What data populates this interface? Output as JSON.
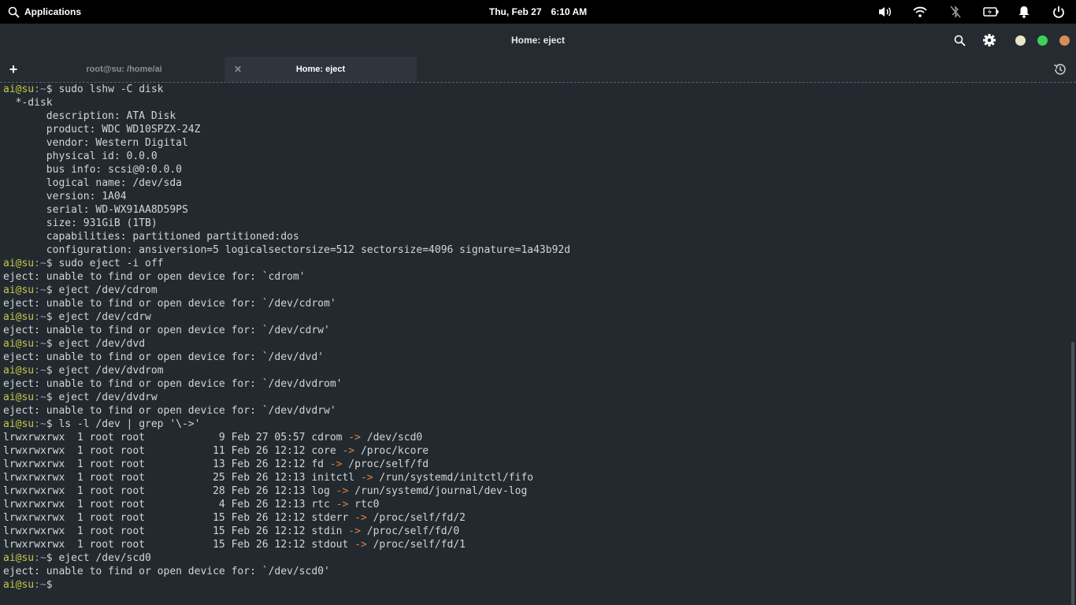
{
  "panel": {
    "apps_label": "Applications",
    "date": "Thu, Feb 27",
    "time": "6:10 AM"
  },
  "window": {
    "title": "Home: eject"
  },
  "tabs": [
    {
      "label": "root@su: /home/ai"
    },
    {
      "label": "Home: eject"
    }
  ],
  "colors": {
    "prompt_user": "#c9c64a",
    "arrow": "#e0803a",
    "background": "#222a30",
    "dot_1": "#e6e6c8",
    "dot_2": "#3cd15a",
    "dot_3": "#d98a5a"
  },
  "terminal": {
    "prompt_user": "ai@su",
    "prompt_sep": ":",
    "prompt_path": "~",
    "prompt_sym": "$",
    "lines": [
      {
        "t": "cmd",
        "text": " sudo lshw -C disk"
      },
      {
        "t": "out",
        "text": "  *-disk"
      },
      {
        "t": "out",
        "text": "       description: ATA Disk"
      },
      {
        "t": "out",
        "text": "       product: WDC WD10SPZX-24Z"
      },
      {
        "t": "out",
        "text": "       vendor: Western Digital"
      },
      {
        "t": "out",
        "text": "       physical id: 0.0.0"
      },
      {
        "t": "out",
        "text": "       bus info: scsi@0:0.0.0"
      },
      {
        "t": "out",
        "text": "       logical name: /dev/sda"
      },
      {
        "t": "out",
        "text": "       version: 1A04"
      },
      {
        "t": "out",
        "text": "       serial: WD-WX91AA8D59PS"
      },
      {
        "t": "out",
        "text": "       size: 931GiB (1TB)"
      },
      {
        "t": "out",
        "text": "       capabilities: partitioned partitioned:dos"
      },
      {
        "t": "out",
        "text": "       configuration: ansiversion=5 logicalsectorsize=512 sectorsize=4096 signature=1a43b92d"
      },
      {
        "t": "cmd",
        "text": " sudo eject -i off"
      },
      {
        "t": "out",
        "text": "eject: unable to find or open device for: `cdrom'"
      },
      {
        "t": "cmd",
        "text": " eject /dev/cdrom"
      },
      {
        "t": "out",
        "text": "eject: unable to find or open device for: `/dev/cdrom'"
      },
      {
        "t": "cmd",
        "text": " eject /dev/cdrw"
      },
      {
        "t": "out",
        "text": "eject: unable to find or open device for: `/dev/cdrw'"
      },
      {
        "t": "cmd",
        "text": " eject /dev/dvd"
      },
      {
        "t": "out",
        "text": "eject: unable to find or open device for: `/dev/dvd'"
      },
      {
        "t": "cmd",
        "text": " eject /dev/dvdrom"
      },
      {
        "t": "out",
        "text": "eject: unable to find or open device for: `/dev/dvdrom'"
      },
      {
        "t": "cmd",
        "text": " eject /dev/dvdrw"
      },
      {
        "t": "out",
        "text": "eject: unable to find or open device for: `/dev/dvdrw'"
      },
      {
        "t": "cmd",
        "text": " ls -l /dev | grep '\\->'"
      },
      {
        "t": "ls",
        "left": "lrwxrwxrwx  1 root root            9 Feb 27 05:57 cdrom ",
        "right": " /dev/scd0"
      },
      {
        "t": "ls",
        "left": "lrwxrwxrwx  1 root root           11 Feb 26 12:12 core ",
        "right": " /proc/kcore"
      },
      {
        "t": "ls",
        "left": "lrwxrwxrwx  1 root root           13 Feb 26 12:12 fd ",
        "right": " /proc/self/fd"
      },
      {
        "t": "ls",
        "left": "lrwxrwxrwx  1 root root           25 Feb 26 12:13 initctl ",
        "right": " /run/systemd/initctl/fifo"
      },
      {
        "t": "ls",
        "left": "lrwxrwxrwx  1 root root           28 Feb 26 12:13 log ",
        "right": " /run/systemd/journal/dev-log"
      },
      {
        "t": "ls",
        "left": "lrwxrwxrwx  1 root root            4 Feb 26 12:13 rtc ",
        "right": " rtc0"
      },
      {
        "t": "ls",
        "left": "lrwxrwxrwx  1 root root           15 Feb 26 12:12 stderr ",
        "right": " /proc/self/fd/2"
      },
      {
        "t": "ls",
        "left": "lrwxrwxrwx  1 root root           15 Feb 26 12:12 stdin ",
        "right": " /proc/self/fd/0"
      },
      {
        "t": "ls",
        "left": "lrwxrwxrwx  1 root root           15 Feb 26 12:12 stdout ",
        "right": " /proc/self/fd/1"
      },
      {
        "t": "cmd",
        "text": " eject /dev/scd0"
      },
      {
        "t": "out",
        "text": "eject: unable to find or open device for: `/dev/scd0'"
      },
      {
        "t": "cmd",
        "text": ""
      }
    ],
    "arrow": "->"
  }
}
